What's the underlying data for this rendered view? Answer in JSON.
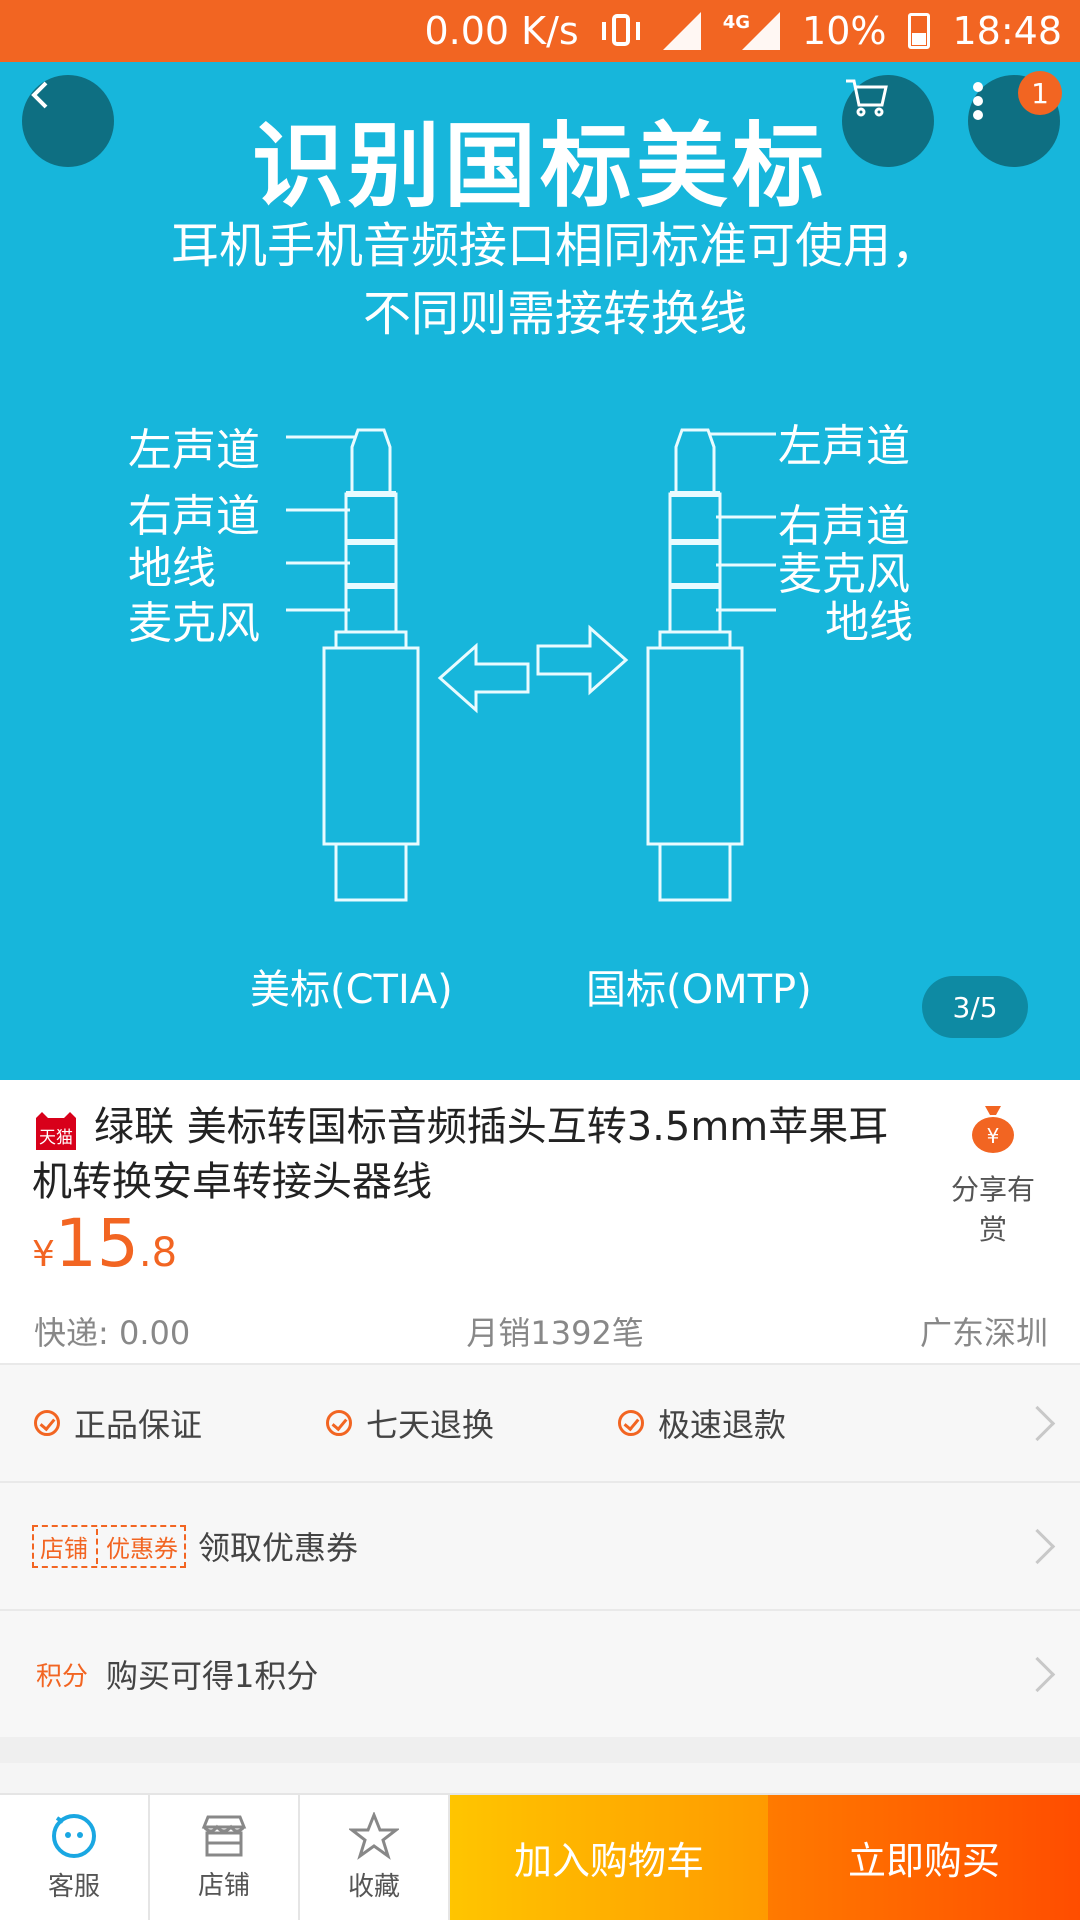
{
  "status_bar": {
    "speed": "0.00 K/s",
    "network": "4G",
    "battery": "10%",
    "time": "18:48"
  },
  "hero": {
    "title": "识别国标美标",
    "subtitle": "耳机手机音频接口相同标准可使用，不同则需接转换线",
    "left_labels": [
      "左声道",
      "右声道",
      "地线",
      "麦克风"
    ],
    "right_labels": [
      "左声道",
      "右声道",
      "麦克风",
      "地线"
    ],
    "left_caption": "美标(CTIA)",
    "right_caption": "国标(OMTP)",
    "counter": "3/5",
    "menu_badge": "1"
  },
  "product": {
    "badge_text": "天猫",
    "title": "绿联 美标转国标音频插头互转3.5mm苹果耳机转换安卓转接头器线",
    "share_label": "分享有赏",
    "price_currency": "¥",
    "price_int": "15",
    "price_dec": ".8",
    "shipping": "快递: 0.00",
    "monthly_sales": "月销1392笔",
    "location": "广东深圳"
  },
  "guarantees": [
    "正品保证",
    "七天退换",
    "极速退款"
  ],
  "coupon": {
    "tag_left": "店铺",
    "tag_right": "优惠券",
    "label": "领取优惠券"
  },
  "points": {
    "tag": "积分",
    "label": "购买可得1积分"
  },
  "bottom_bar": {
    "service": "客服",
    "shop": "店铺",
    "favorite": "收藏",
    "add_to_cart": "加入购物车",
    "buy_now": "立即购买"
  },
  "colors": {
    "accent": "#f26522",
    "hero_bg": "#17b6db",
    "cart_button": "#ffb300",
    "buy_button": "#ff5a00"
  }
}
